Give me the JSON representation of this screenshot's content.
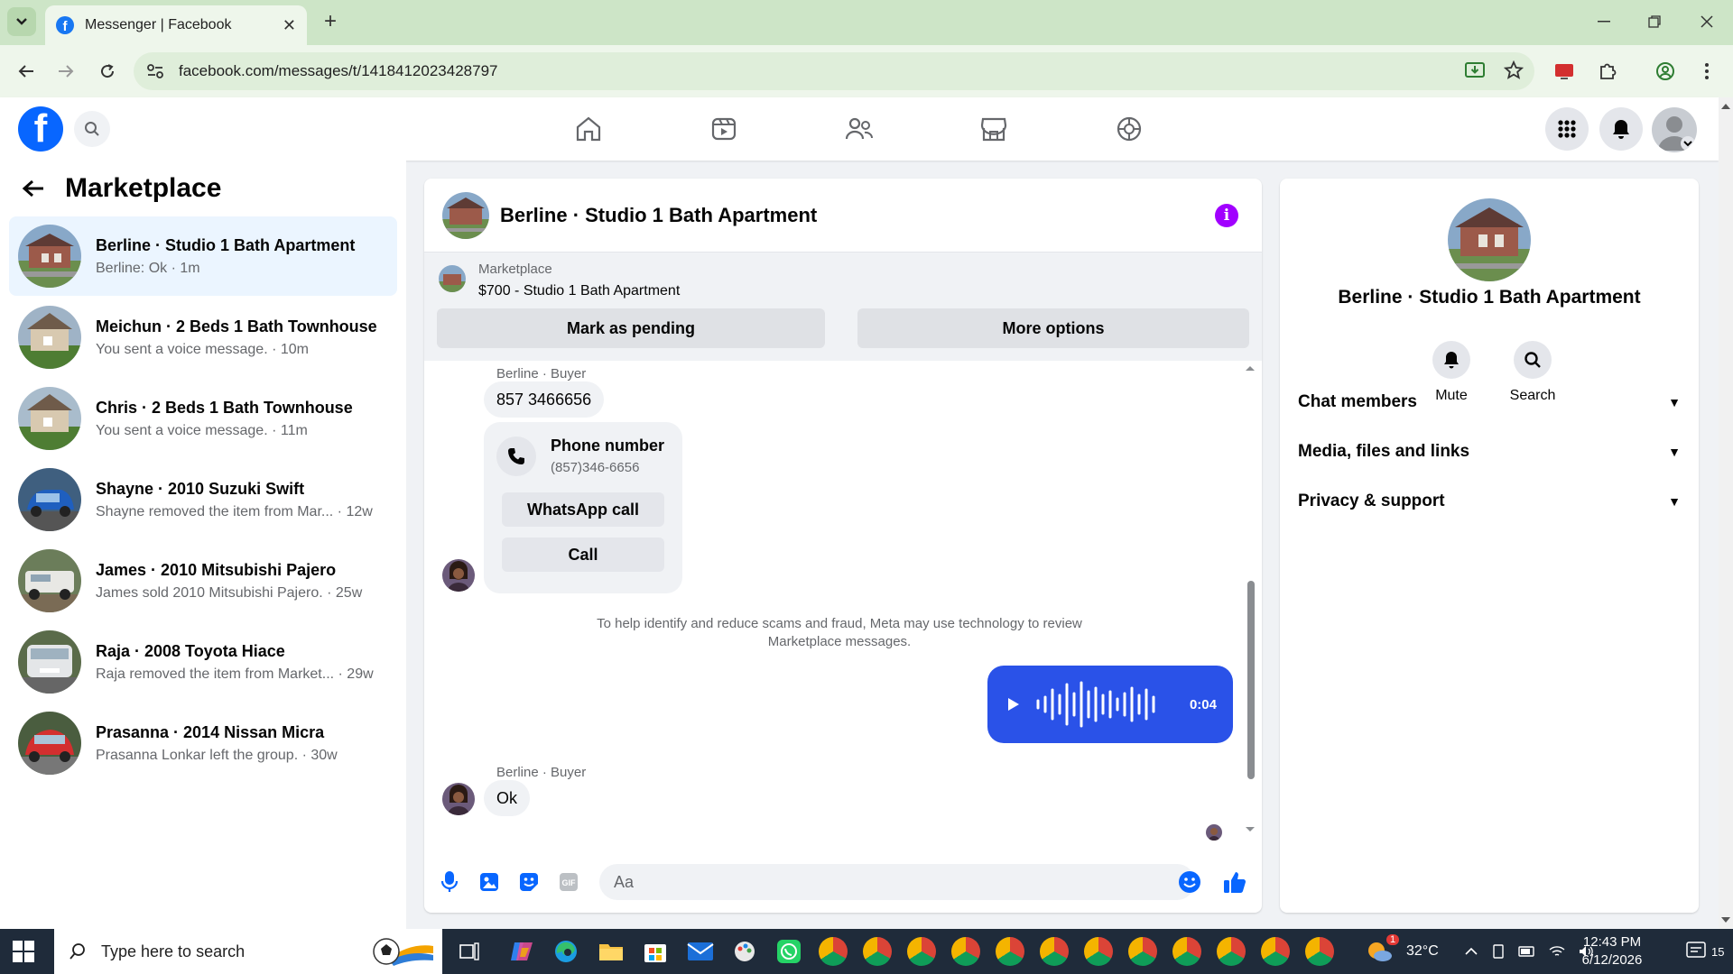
{
  "browser": {
    "tab_title": "Messenger | Facebook",
    "url": "facebook.com/messages/t/1418412023428797",
    "tab_close": "✕",
    "new_tab": "+"
  },
  "left": {
    "title": "Marketplace",
    "conversations": [
      {
        "name": "Berline · Studio 1 Bath Apartment",
        "preview": "Berline: Ok · 1m",
        "active": true
      },
      {
        "name": "Meichun · 2 Beds 1 Bath Townhouse",
        "preview": "You sent a voice message. · 10m"
      },
      {
        "name": "Chris · 2 Beds 1 Bath Townhouse",
        "preview": "You sent a voice message. · 11m"
      },
      {
        "name": "Shayne · 2010 Suzuki Swift",
        "preview": "Shayne removed the item from Mar... · 12w"
      },
      {
        "name": "James · 2010 Mitsubishi Pajero",
        "preview": "James sold 2010 Mitsubishi Pajero. · 25w"
      },
      {
        "name": "Raja · 2008 Toyota Hiace",
        "preview": "Raja removed the item from Market... · 29w"
      },
      {
        "name": "Prasanna · 2014 Nissan Micra",
        "preview": "Prasanna Lonkar left the group. · 30w"
      }
    ]
  },
  "chat": {
    "title": "Berline · Studio 1 Bath Apartment",
    "info_glyph": "i",
    "listing_label": "Marketplace",
    "listing_price": "$700 - Studio 1 Bath Apartment",
    "mark_pending": "Mark as pending",
    "more_options": "More options",
    "sender1": "Berline · Buyer",
    "msg_number": "857 3466656",
    "phone_title": "Phone number",
    "phone_value": "(857)346-6656",
    "whatsapp_call": "WhatsApp call",
    "call": "Call",
    "notice": "To help identify and reduce scams and fraud, Meta may use technology to review Marketplace messages.",
    "voice_duration": "0:04",
    "sender2": "Berline · Buyer",
    "msg_ok": "Ok",
    "composer_placeholder": "Aa"
  },
  "right": {
    "title": "Berline · Studio 1 Bath Apartment",
    "mute": "Mute",
    "search": "Search",
    "sections": [
      "Chat members",
      "Media, files and links",
      "Privacy & support"
    ],
    "chevron": "▼"
  },
  "taskbar": {
    "search_placeholder": "Type here to search",
    "temperature": "32°C",
    "time": "12:43 PM",
    "date": "6/12/2026",
    "weather_badge": "1",
    "notif_count": "15"
  },
  "colors": {
    "fb_blue": "#0866ff",
    "voice_bubble": "#2a52e8",
    "info_purple": "#a100ff",
    "active_row": "#ebf5ff"
  }
}
